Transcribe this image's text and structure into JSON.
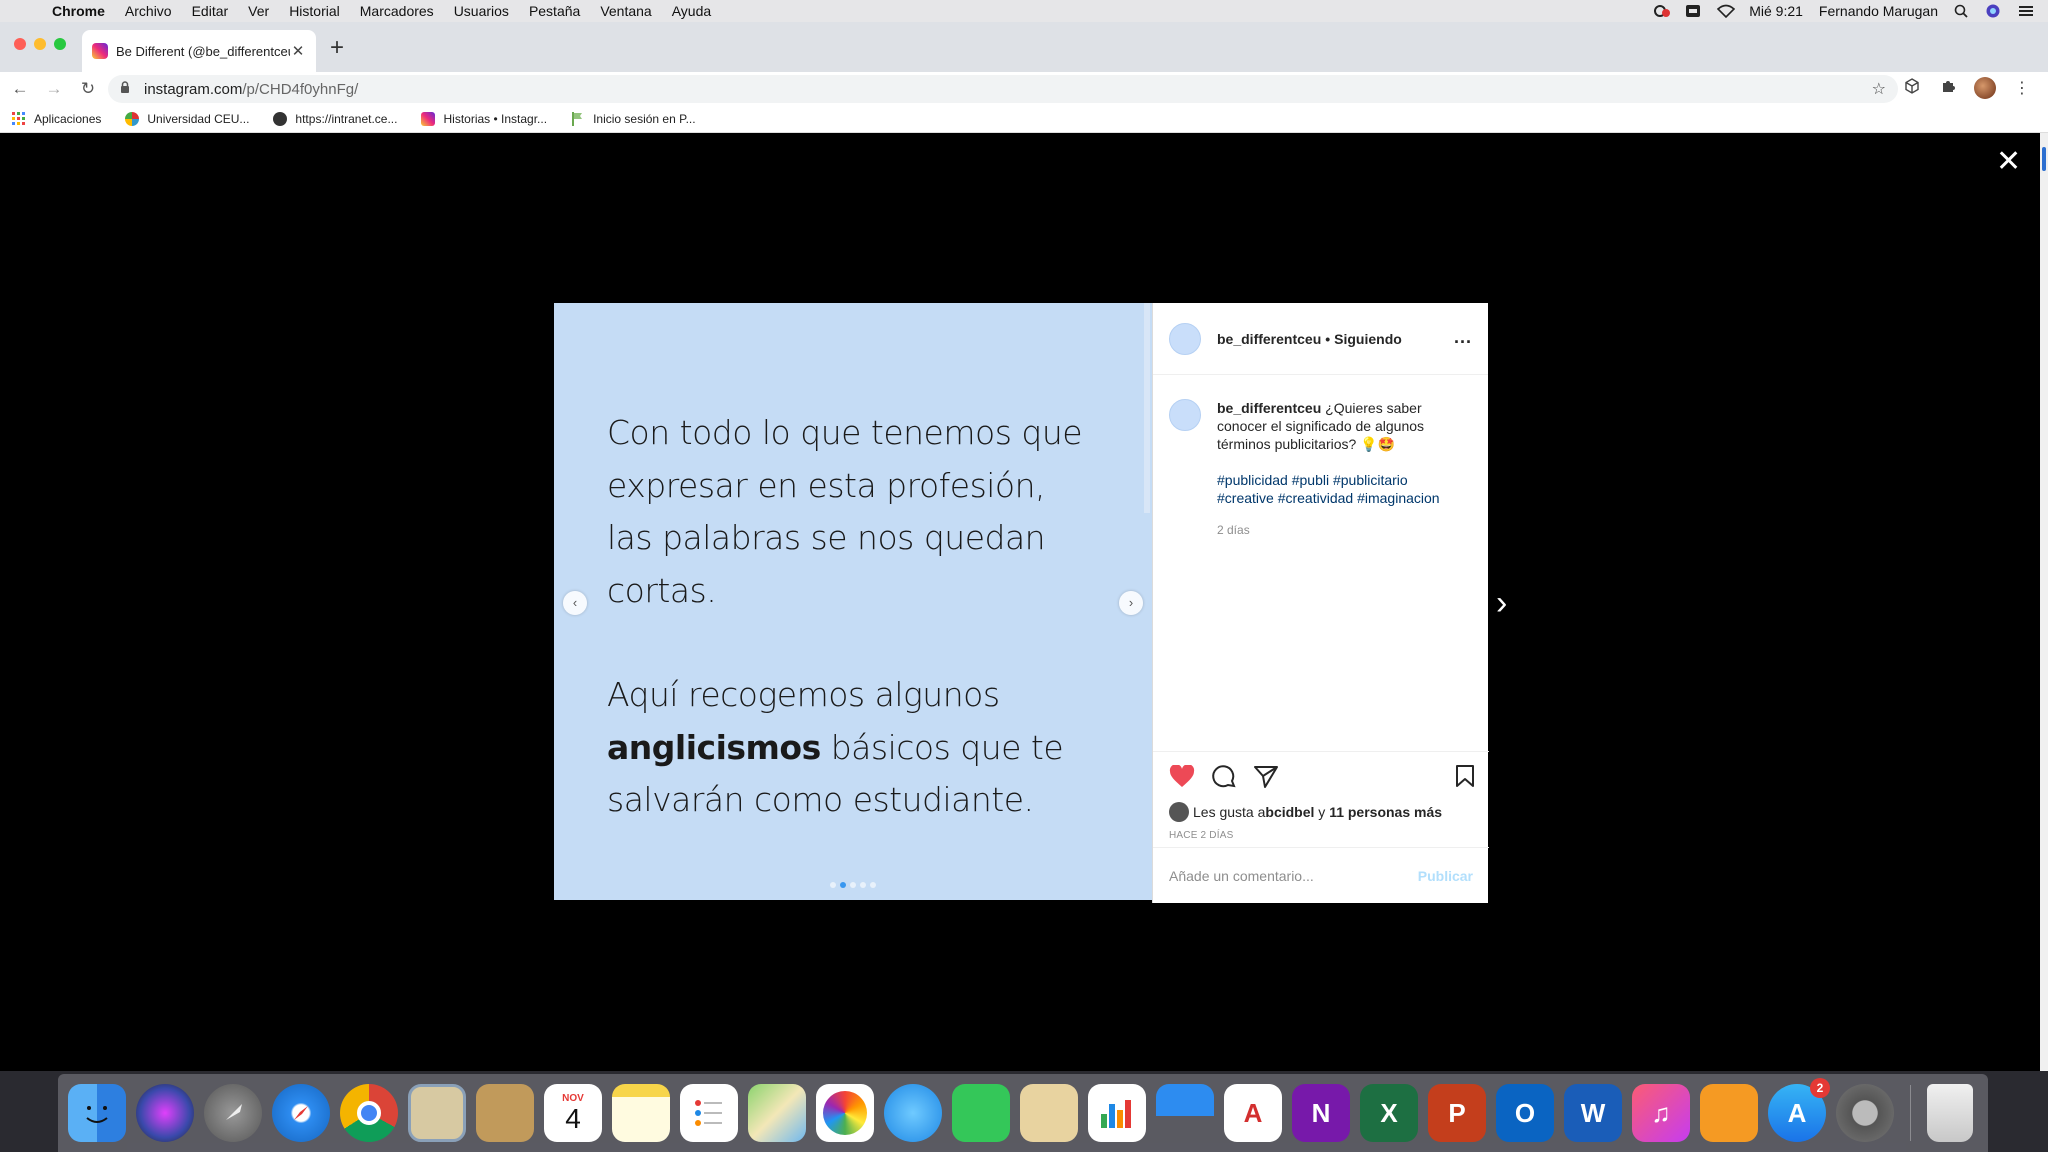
{
  "menubar": {
    "app": "Chrome",
    "items": [
      "Archivo",
      "Editar",
      "Ver",
      "Historial",
      "Marcadores",
      "Usuarios",
      "Pestaña",
      "Ventana",
      "Ayuda"
    ],
    "clock": "Mié 9:21",
    "user": "Fernando Marugan"
  },
  "browser": {
    "tab_title": "Be Different (@be_differentceu",
    "url_host": "instagram.com",
    "url_path": "/p/CHD4f0yhnFg/",
    "bookmarks": [
      "Aplicaciones",
      "Universidad CEU...",
      "https://intranet.ce...",
      "Historias • Instagr...",
      "Inicio sesión en P..."
    ]
  },
  "post": {
    "slide_line1": "Con todo lo que tenemos que",
    "slide_line2": "expresar en esta profesión,",
    "slide_line3": "las palabras se nos quedan cortas.",
    "slide_line4": "Aquí recogemos algunos",
    "slide_bold": "anglicismos",
    "slide_line5": " básicos que te",
    "slide_line6": "salvarán como estudiante.",
    "username": "be_differentceu",
    "separator": "•",
    "following": "Siguiendo",
    "more": "...",
    "caption": "¿Quieres saber conocer el significado de algunos términos publicitarios? 💡🤩",
    "hashtags": "#publicidad #publi #publicitario #creative #creatividad #imaginacion",
    "time_caption": "2 días",
    "likes_prefix": "Les gusta a ",
    "likes_user": "bcidbel",
    "likes_mid": " y ",
    "likes_rest": "11 personas más",
    "time_ago": "HACE 2 DÍAS",
    "comment_placeholder": "Añade un comentario...",
    "publish": "Publicar"
  },
  "dock": {
    "calendar_month": "NOV",
    "calendar_day": "4",
    "appstore_badge": "2"
  },
  "colors": {
    "slide_bg": "#c5dcf5",
    "heart": "#ed4956",
    "link": "#00376b",
    "publish": "#b2dffc"
  }
}
